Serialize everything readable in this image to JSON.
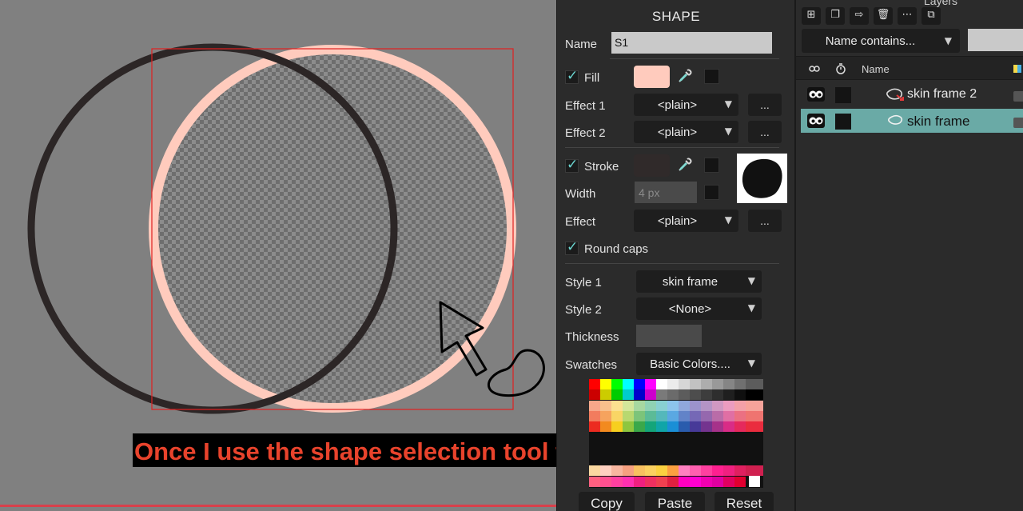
{
  "shape_panel": {
    "title": "SHAPE",
    "name_label": "Name",
    "name_value": "S1",
    "fill_label": "Fill",
    "fill_color": "#ffcbbd",
    "effect1_label": "Effect 1",
    "effect1_value": "<plain>",
    "effect2_label": "Effect 2",
    "effect2_value": "<plain>",
    "stroke_label": "Stroke",
    "stroke_color": "#302a2a",
    "width_label": "Width",
    "width_value": "4 px",
    "effect_label": "Effect",
    "effect_value": "<plain>",
    "round_caps_label": "Round caps",
    "style1_label": "Style 1",
    "style1_value": "skin frame",
    "style2_label": "Style 2",
    "style2_value": "<None>",
    "thickness_label": "Thickness",
    "swatches_label": "Swatches",
    "swatches_value": "Basic Colors....",
    "more_label": "...",
    "copy_label": "Copy",
    "paste_label": "Paste",
    "reset_label": "Reset"
  },
  "layers_panel": {
    "title": "Layers",
    "filter_label": "Name contains...",
    "name_column": "Name",
    "layers": [
      {
        "name": "skin frame 2",
        "selected": false
      },
      {
        "name": "skin frame",
        "selected": true
      }
    ],
    "selected_color": "#6aaaa6"
  },
  "caption": {
    "text": "Once I use the shape selection tool to select the original layer…",
    "color": "#e8432c"
  },
  "colors": {
    "selection_box": "#e02020",
    "canvas_bg": "#808080",
    "panel_bg": "#2b2b2b"
  }
}
